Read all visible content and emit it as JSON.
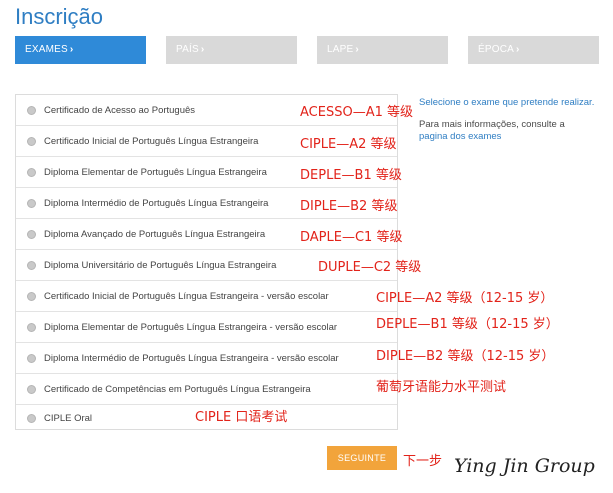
{
  "page_title": "Inscrição",
  "steps": [
    {
      "label": "EXAMES",
      "active": true
    },
    {
      "label": "PAÍS",
      "active": false
    },
    {
      "label": "LAPE",
      "active": false
    },
    {
      "label": "ÉPOCA",
      "active": false
    }
  ],
  "exams": [
    {
      "label": "Certificado de Acesso ao Português",
      "annotation": "ACESSO—A1 等级"
    },
    {
      "label": "Certificado Inicial de Português Língua Estrangeira",
      "annotation": "CIPLE—A2 等级"
    },
    {
      "label": "Diploma Elementar de Português Língua Estrangeira",
      "annotation": "DEPLE—B1 等级"
    },
    {
      "label": "Diploma Intermédio de Português Língua Estrangeira",
      "annotation": "DIPLE—B2 等级"
    },
    {
      "label": "Diploma Avançado de Português Língua Estrangeira",
      "annotation": "DAPLE—C1 等级"
    },
    {
      "label": "Diploma Universitário de Português Língua Estrangeira",
      "annotation": "DUPLE—C2 等级"
    },
    {
      "label": "Certificado Inicial de Português Língua Estrangeira - versão escolar",
      "annotation": "CIPLE—A2 等级（12-15 岁）"
    },
    {
      "label": "Diploma Elementar de Português Língua Estrangeira - versão escolar",
      "annotation": "DEPLE—B1 等级（12-15 岁）"
    },
    {
      "label": "Diploma Intermédio de Português Língua Estrangeira - versão escolar",
      "annotation": "DIPLE—B2 等级（12-15 岁）"
    },
    {
      "label": "Certificado de Competências em Português Língua Estrangeira",
      "annotation": "葡萄牙语能力水平测试"
    },
    {
      "label": "CIPLE Oral",
      "annotation": "CIPLE 口语考试"
    }
  ],
  "side": {
    "hint": "Selecione o exame que pretende realizar.",
    "info_prefix": "Para mais informações, consulte a",
    "info_link": "pagina dos exames"
  },
  "next_button": "SEGUINTE",
  "next_annotation": "下一步",
  "watermark": "Ying Jin Group",
  "colors": {
    "title": "#2f7ec3",
    "step_active": "#2f8ad8",
    "step_inactive": "#d9d9d9",
    "annotation_red": "#e2231a",
    "button_orange": "#f2a43b"
  }
}
